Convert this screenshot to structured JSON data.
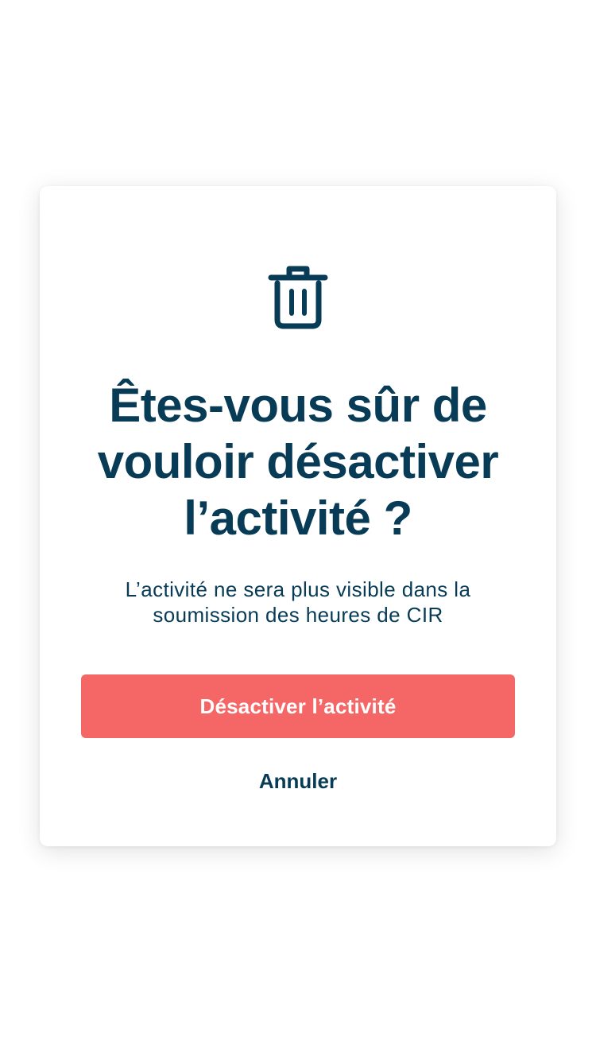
{
  "dialog": {
    "icon": "trash-icon",
    "title": "Êtes-vous sûr de vouloir désactiver l’activité ?",
    "message": "L’activité ne sera plus visible dans la soumission des heures de CIR",
    "confirm_label": "Désactiver l’activité",
    "cancel_label": "Annuler"
  },
  "colors": {
    "primary_text": "#073b56",
    "danger": "#f56767",
    "background": "#ffffff"
  }
}
